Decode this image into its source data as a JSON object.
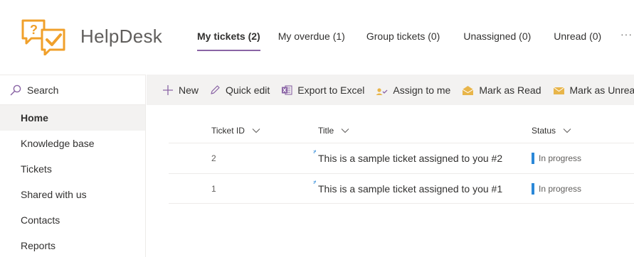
{
  "app": {
    "title": "HelpDesk"
  },
  "tabs": [
    {
      "label": "My tickets (2)",
      "active": true
    },
    {
      "label": "My overdue (1)"
    },
    {
      "label": "Group tickets (0)"
    },
    {
      "label": "Unassigned (0)"
    },
    {
      "label": "Unread (0)"
    }
  ],
  "more_label": "···",
  "search": {
    "label": "Search"
  },
  "nav": [
    {
      "label": "Home",
      "selected": true
    },
    {
      "label": "Knowledge base"
    },
    {
      "label": "Tickets"
    },
    {
      "label": "Shared with us"
    },
    {
      "label": "Contacts"
    },
    {
      "label": "Reports"
    }
  ],
  "commands": [
    {
      "label": "New",
      "icon": "plus-icon"
    },
    {
      "label": "Quick edit",
      "icon": "pencil-icon"
    },
    {
      "label": "Export to Excel",
      "icon": "excel-icon"
    },
    {
      "label": "Assign to me",
      "icon": "assign-person-icon"
    },
    {
      "label": "Mark as Read",
      "icon": "open-envelope-icon"
    },
    {
      "label": "Mark as Unread",
      "icon": "closed-envelope-icon"
    }
  ],
  "table": {
    "columns": [
      "Ticket ID",
      "Title",
      "Status"
    ],
    "rows": [
      {
        "id": "2",
        "title": "This is a sample ticket assigned to you #2",
        "status": "In progress"
      },
      {
        "id": "1",
        "title": "This is a sample ticket assigned to you #1",
        "status": "In progress"
      }
    ]
  },
  "colors": {
    "accent": "#8a64a5",
    "status_in_progress": "#2b88d8",
    "logo": "#f0a02b",
    "envelope": "#e8b54a"
  }
}
